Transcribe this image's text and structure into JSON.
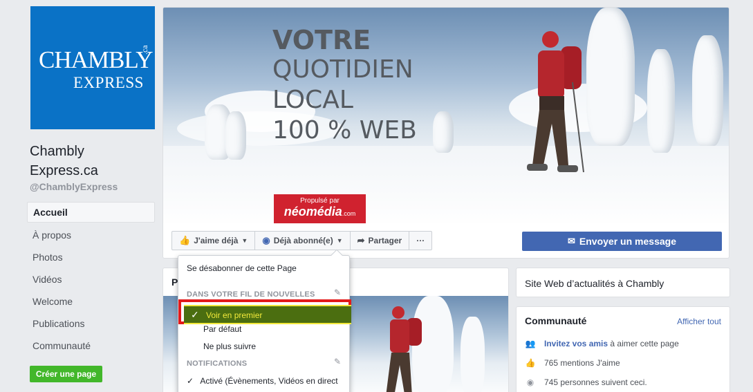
{
  "page": {
    "logo": {
      "line1": "CHAMBLY",
      "line1_suffix": ".ca",
      "line2": "EXPRESS"
    },
    "name": "Chambly Express.ca",
    "handle": "@ChamblyExpress"
  },
  "nav": {
    "items": [
      {
        "label": "Accueil"
      },
      {
        "label": "À propos"
      },
      {
        "label": "Photos"
      },
      {
        "label": "Vidéos"
      },
      {
        "label": "Welcome"
      },
      {
        "label": "Publications"
      },
      {
        "label": "Communauté"
      }
    ],
    "create_page": "Créer une page"
  },
  "cover": {
    "line1": "VOTRE",
    "line2": "QUOTIDIEN",
    "line3": "LOCAL",
    "line4": "100 % WEB",
    "sponsor_prefix": "Propulsé par",
    "sponsor_name": "néomédia",
    "sponsor_suffix": ".com"
  },
  "actions": {
    "like": "J'aime déjà",
    "subscribed": "Déjà abonné(e)",
    "share": "Partager",
    "more": "···",
    "message": "Envoyer un message"
  },
  "posts": {
    "header": "Pl"
  },
  "about": {
    "text": "Site Web d’actualités à Chambly"
  },
  "community": {
    "title": "Communauté",
    "see_all": "Afficher tout",
    "invite_link": "Invitez vos amis",
    "invite_rest": " à aimer cette page",
    "likes": "765 mentions J'aime",
    "followers": "745 personnes suivent ceci."
  },
  "dropdown": {
    "unsubscribe": "Se désabonner de cette Page",
    "section_feed": "DANS VOTRE FIL DE NOUVELLES",
    "see_first": "Voir en premier",
    "default": "Par défaut",
    "unfollow": "Ne plus suivre",
    "section_notifications": "NOTIFICATIONS",
    "active": "Activé (Évènements, Vidéos en direct"
  },
  "colors": {
    "brand_blue": "#0a72c6",
    "fb_blue": "#4267b2",
    "green": "#42b72a",
    "highlight_red": "#e31a1a",
    "selected_bg": "#4b6e10",
    "selected_text": "#f2e93b"
  }
}
